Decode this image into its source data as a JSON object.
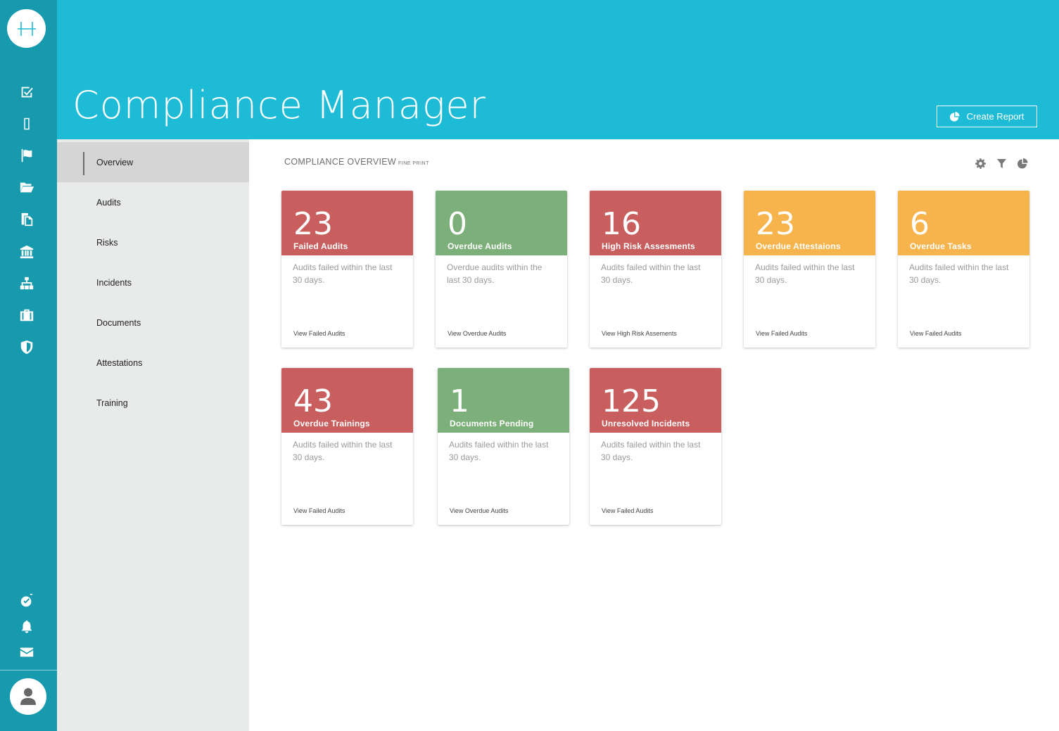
{
  "header": {
    "title": "Compliance Manager",
    "create_report_label": "Create Report"
  },
  "rail": {
    "top_icons": [
      "checkbox-icon",
      "mobile-icon",
      "flag-icon",
      "folder-open-icon",
      "copy-icon",
      "bank-icon",
      "sitemap-icon",
      "briefcase-icon",
      "shield-icon"
    ],
    "bottom_icons": [
      "check-circle-icon",
      "bell-icon",
      "envelope-icon"
    ]
  },
  "subnav": {
    "items": [
      {
        "label": "Overview",
        "active": true
      },
      {
        "label": "Audits",
        "active": false
      },
      {
        "label": "Risks",
        "active": false
      },
      {
        "label": "Incidents",
        "active": false
      },
      {
        "label": "Documents",
        "active": false
      },
      {
        "label": "Attestations",
        "active": false
      },
      {
        "label": "Training",
        "active": false
      }
    ]
  },
  "overview": {
    "title": "COMPLIANCE OVERVIEW",
    "fine_print": "FINE PRINT",
    "tools": [
      "gear-icon",
      "filter-icon",
      "pie-chart-icon"
    ]
  },
  "colors": {
    "red": "#c85e5e",
    "green": "#7caf79",
    "orange": "#f7b34c",
    "header": "#1ebbd6",
    "rail": "#1799ae"
  },
  "cards": [
    {
      "value": "23",
      "label": "Failed Audits",
      "desc": "Audits failed within the last 30 days.",
      "link": "View Failed Audits",
      "color": "red"
    },
    {
      "value": "0",
      "label": "Overdue Audits",
      "desc": "Overdue audits within the last 30 days.",
      "link": "View Overdue Audits",
      "color": "green"
    },
    {
      "value": "16",
      "label": "High Risk Assesments",
      "desc": "Audits failed within the last 30 days.",
      "link": "View High Risk Assements",
      "color": "red"
    },
    {
      "value": "23",
      "label": "Overdue Attestaions",
      "desc": "Audits failed within the last 30 days.",
      "link": "View Failed Audits",
      "color": "orange"
    },
    {
      "value": "6",
      "label": "Overdue Tasks",
      "desc": "Audits failed within the last 30 days.",
      "link": "View Failed Audits",
      "color": "orange"
    },
    {
      "value": "43",
      "label": "Overdue Trainings",
      "desc": "Audits failed within the last 30 days.",
      "link": "View Failed Audits",
      "color": "red"
    },
    {
      "value": "1",
      "label": "Documents Pending",
      "desc": "Audits failed within the last 30 days.",
      "link": "View Overdue Audits",
      "color": "green"
    },
    {
      "value": "125",
      "label": "Unresolved Incidents",
      "desc": "Audits failed within the last 30 days.",
      "link": "View Failed Audits",
      "color": "red"
    }
  ]
}
